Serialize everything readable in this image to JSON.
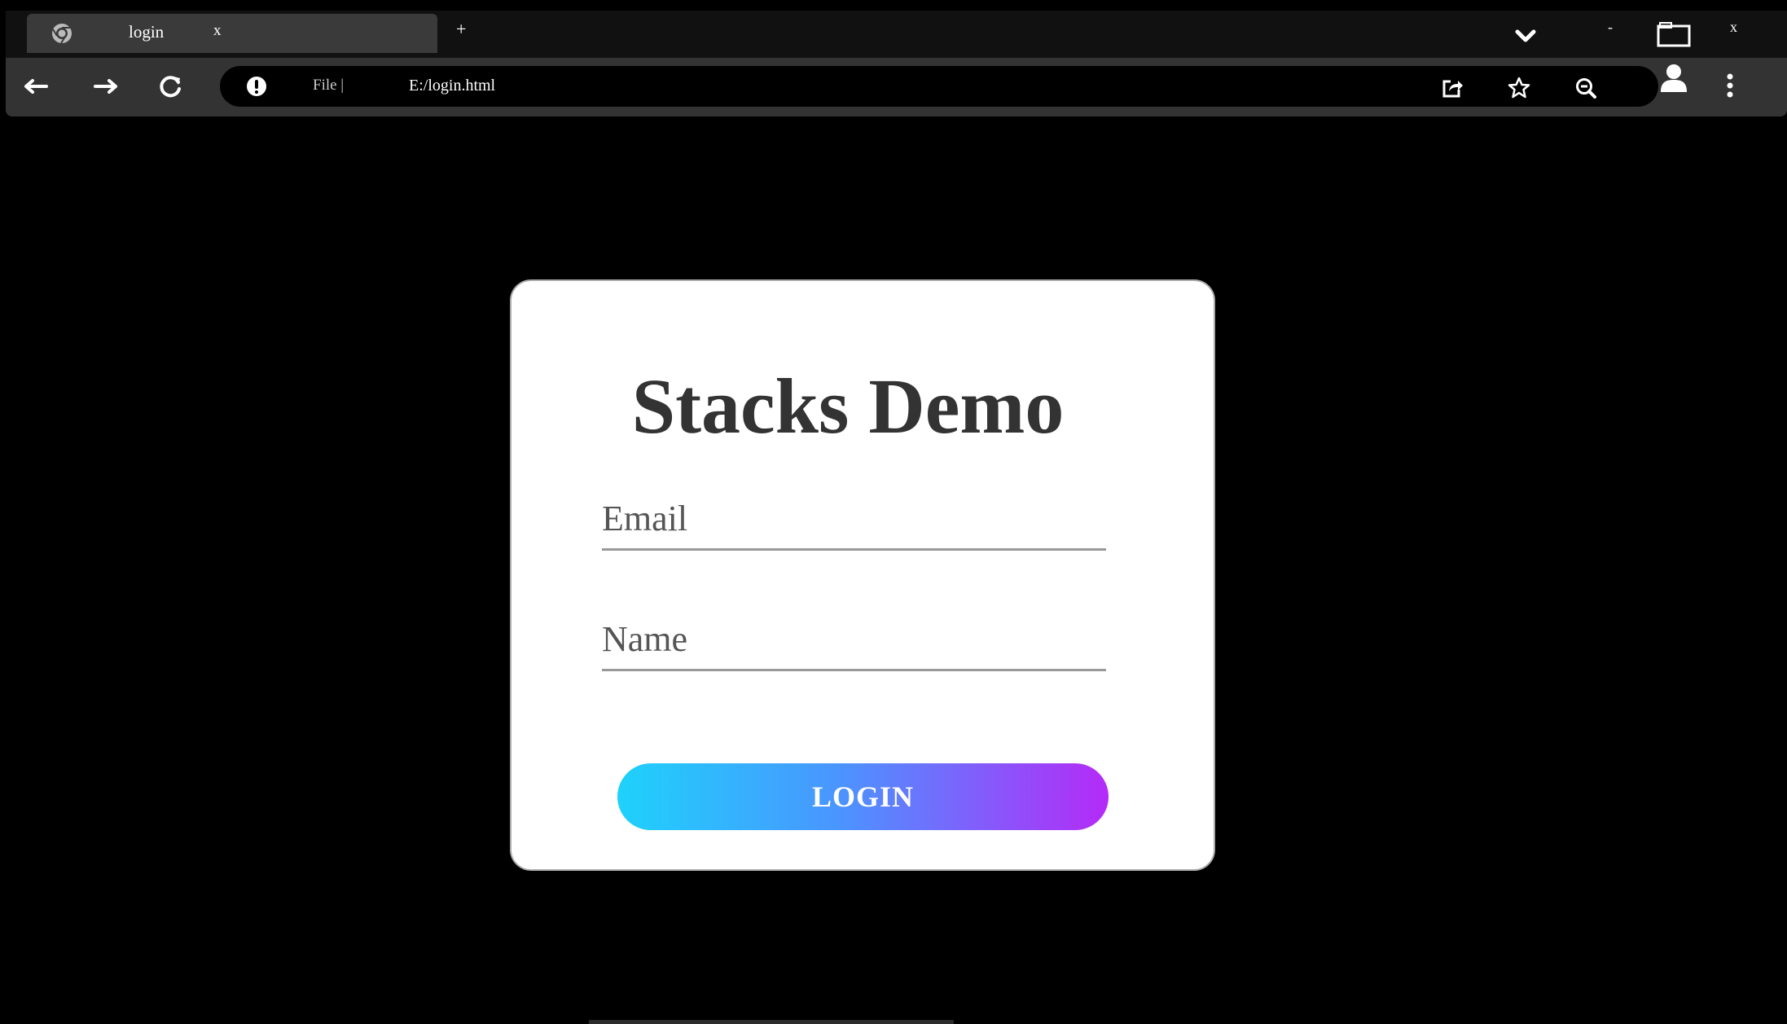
{
  "browser": {
    "tab": {
      "title": "login",
      "close_label": "x"
    },
    "new_tab_label": "+",
    "window_controls": {
      "minimize_label": "-",
      "close_label": "x"
    },
    "address_bar": {
      "scheme_label": "File |",
      "url": "E:/login.html"
    }
  },
  "login_card": {
    "title": "Stacks Demo",
    "email_placeholder": "Email",
    "name_placeholder": "Name",
    "login_label": "LOGIN"
  },
  "colors": {
    "page_background": "#000000",
    "card_background": "#ffffff",
    "gradient_start": "#1ed2fb",
    "gradient_end": "#b52af7",
    "title_color": "#333333"
  }
}
